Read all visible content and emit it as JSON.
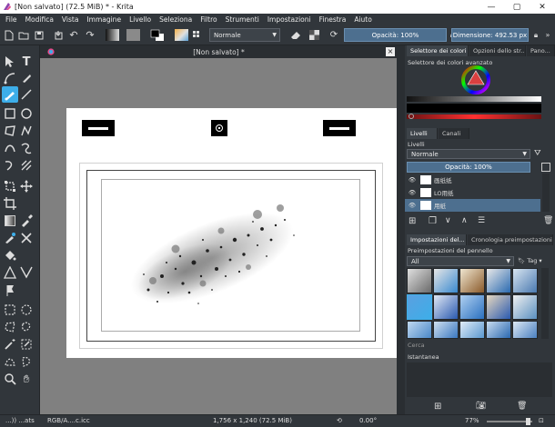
{
  "title": "[Non salvato]  (72.5 MiB)  * - Krita",
  "menu": [
    "File",
    "Modifica",
    "Vista",
    "Immagine",
    "Livello",
    "Seleziona",
    "Filtro",
    "Strumenti",
    "Impostazioni",
    "Finestra",
    "Aiuto"
  ],
  "toolbar": {
    "blend_mode": "Normale",
    "opacity_label": "Opacità: 100%",
    "size_label": "Dimensione: 492.53 px"
  },
  "document": {
    "tab_title": "[Non salvato]  *",
    "close": "×"
  },
  "dock": {
    "top_tabs": [
      "Selettore dei colori a...",
      "Opzioni dello str...",
      "Pano..."
    ],
    "color_selector_title": "Selettore dei colori avanzato",
    "layer_tabs": [
      "Livelli",
      "Canali"
    ],
    "layers_title": "Livelli",
    "layer_blend": "Normale",
    "layer_opacity": "Opacità: 100%",
    "layers": [
      {
        "name": "画纸纸"
      },
      {
        "name": "LO用纸"
      },
      {
        "name": "用紙"
      }
    ],
    "preset_tabs": [
      "Impostazioni del...",
      "Cronologia preimpostazioni del..."
    ],
    "presets_title": "Preimpostazioni del pennello",
    "preset_filter": "All",
    "preset_tag": "Tag",
    "search_label": "Cerca",
    "snapshot_title": "Istantanea"
  },
  "status": {
    "left": "...)) ...ats",
    "color_profile": "RGB/A....c.icc",
    "dimensions": "1,756 x 1,240 (72.5 MiB)",
    "rotation": "0.00°",
    "zoom": "77%"
  },
  "colors": {
    "accent": "#3daee9",
    "panel": "#31363b",
    "canvas_bg": "#808080"
  }
}
